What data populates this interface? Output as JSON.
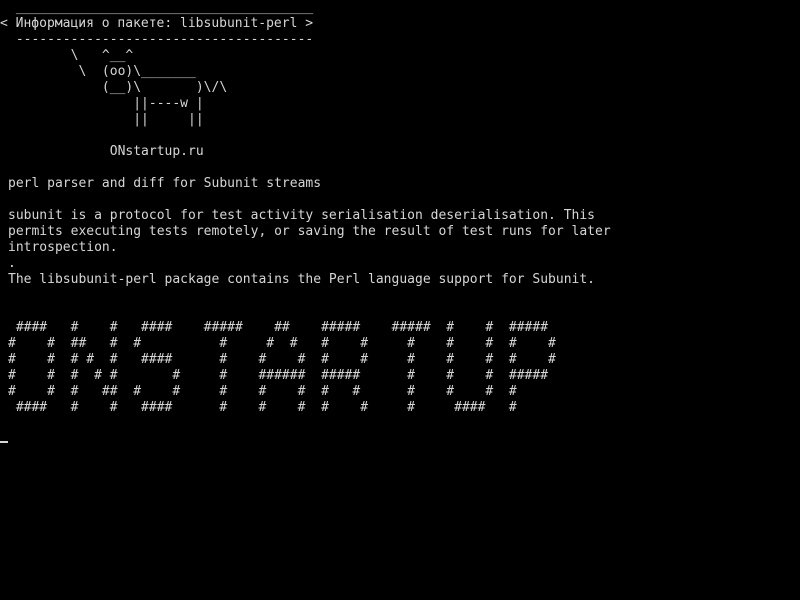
{
  "colors": {
    "background": "#000000",
    "foreground": "#d6d6d6"
  },
  "speech_bubble": {
    "top_border": " ______________________________________",
    "text": "< Информация о пакете: libsubunit-perl >",
    "bottom_border": " --------------------------------------"
  },
  "cow": [
    "        \\   ^__^",
    "         \\  (oo)\\_______",
    "            (__)\\       )\\/\\",
    "                ||----w |",
    "                ||     ||"
  ],
  "site_credit": "             ONstartup.ru",
  "package": {
    "summary": "perl parser and diff for Subunit streams",
    "description_lines": [
      "subunit is a protocol for test activity serialisation deserialisation. This",
      "permits executing tests remotely, or saving the result of test runs for later",
      "introspection.",
      ".",
      "The libsubunit-perl package contains the Perl language support for Subunit."
    ]
  },
  "banner_lines": [
    " ####   #    #   ####    #####    ##    #####    #####  #    #  #####",
    "#    #  ##   #  #          #     #  #   #    #     #    #    #  #    #",
    "#    #  # #  #   ####      #    #    #  #    #     #    #    #  #    #",
    "#    #  #  # #       #     #    ######  #####      #    #    #  #####",
    "#    #  #   ##  #    #     #    #    #  #   #      #    #    #  #",
    " ####   #    #   ####      #    #    #  #    #     #     ####   #"
  ]
}
